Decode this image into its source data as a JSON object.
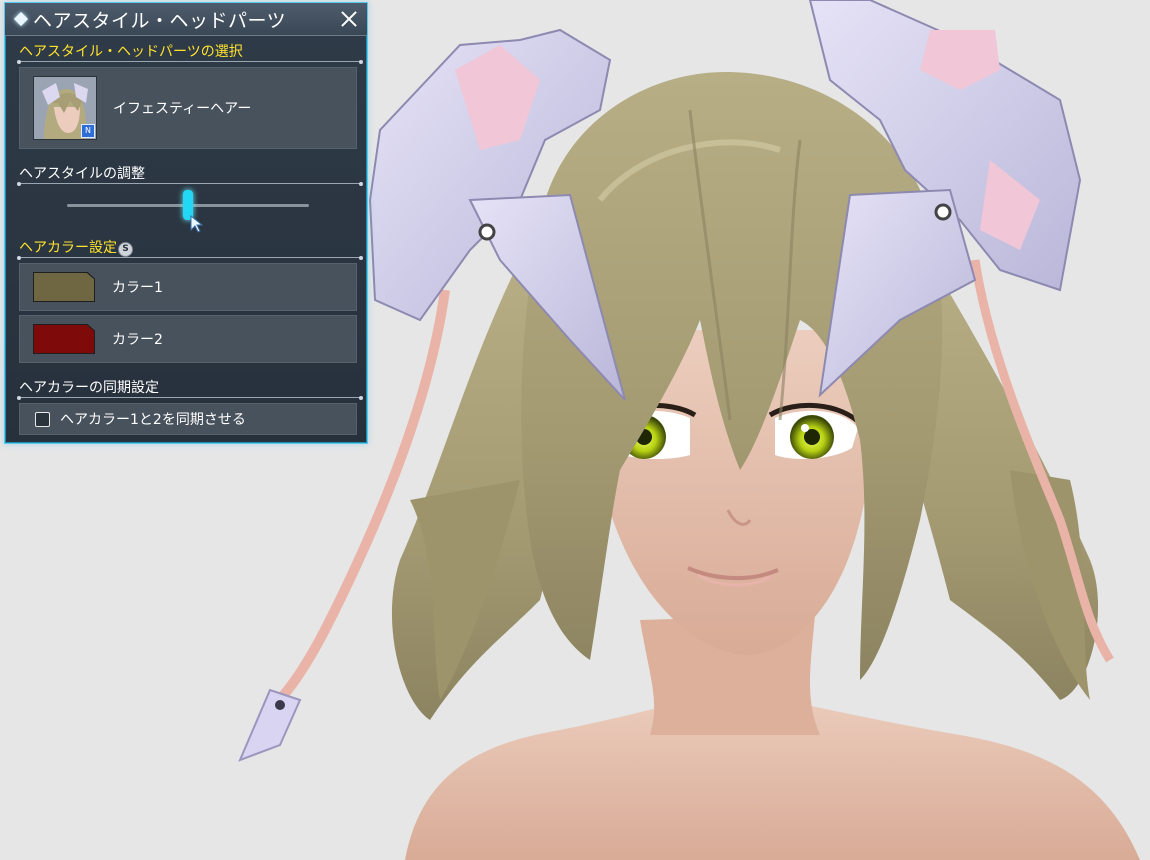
{
  "panel": {
    "title": "ヘアスタイル・ヘッドパーツ",
    "accent_color": "#5ac8e8",
    "sections": {
      "selection": {
        "heading": "ヘアスタイル・ヘッドパーツの選択",
        "item_label": "イフェスティーヘアー",
        "thumbnail_badge": "N"
      },
      "adjust": {
        "heading": "ヘアスタイルの調整",
        "slider_value": 0.5
      },
      "color": {
        "heading": "ヘアカラー設定",
        "heading_icon": "coin-icon",
        "heading_icon_glyph": "S",
        "color1": {
          "label": "カラー1",
          "color": "#6f6642"
        },
        "color2": {
          "label": "カラー2",
          "color": "#7f0a0a"
        }
      },
      "sync": {
        "heading": "ヘアカラーの同期設定",
        "checkbox_label": "ヘアカラー1と2を同期させる",
        "checked": false
      }
    }
  },
  "scene": {
    "background_color": "#e6e6e6",
    "hair_color": "#a9a07a",
    "skin_color": "#e8c4b2",
    "accessory_color": "#d6d2ef",
    "accessory_accent": "#f0c2d2",
    "eye_color": "#c8e020"
  }
}
